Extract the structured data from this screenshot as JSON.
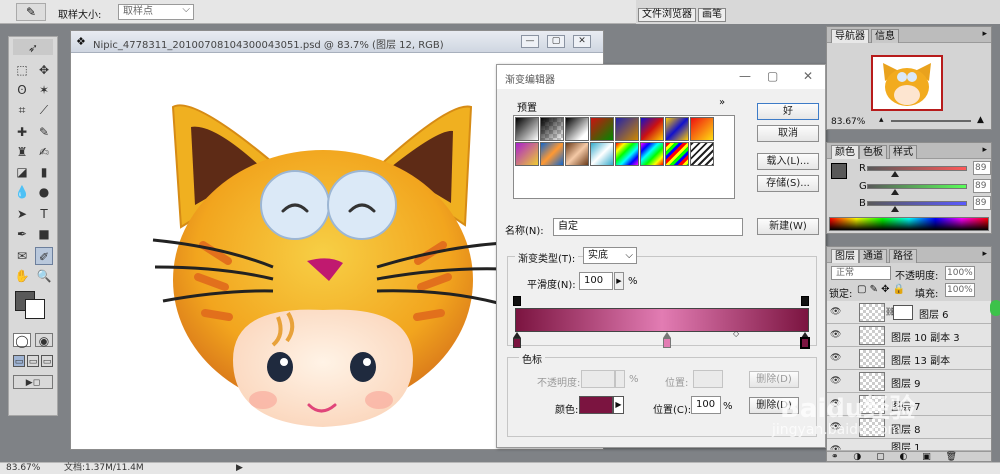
{
  "options_bar": {
    "sample_size_label": "取样大小:",
    "sample_size_value": "取样点"
  },
  "well_tabs": [
    "文件浏览器",
    "画笔"
  ],
  "document": {
    "title": "Nipic_4778311_20100708104300043051.psd @ 83.7% (图层 12, RGB)",
    "btn_min": "—",
    "btn_restore": "▢",
    "btn_close": "✕"
  },
  "status": {
    "zoom": "83.67%",
    "doc_info": "文档:1.37M/11.4M"
  },
  "gradient_editor": {
    "title": "渐变编辑器",
    "presets_label": "预置",
    "presets_more": "»",
    "buttons": {
      "ok": "好",
      "cancel": "取消",
      "load": "载入(L)...",
      "save": "存储(S)...",
      "new": "新建(W)"
    },
    "name_label": "名称(N):",
    "name_value": "自定",
    "gradient_type_label": "渐变类型(T):",
    "gradient_type_value": "实底",
    "smoothness_label": "平滑度(N):",
    "smoothness_value": "100",
    "smoothness_unit": "%",
    "gradient": {
      "start_color": "#7b1440",
      "mid_color": "#e27cb3",
      "end_color": "#7b1440"
    },
    "stops_label": "色标",
    "opacity_label": "不透明度:",
    "opacity_unit": "%",
    "opacity_location_label": "位置:",
    "delete_button_1": "删除(D)",
    "color_label": "颜色:",
    "color_value": "#7b1440",
    "location_label": "位置(C):",
    "location_value": "100",
    "location_unit": "%",
    "delete_button_2": "删除(D)"
  },
  "navigator_panel": {
    "tabs": [
      "导航器",
      "信息"
    ],
    "zoom": "83.67%"
  },
  "color_panel": {
    "tabs": [
      "颜色",
      "色板",
      "样式"
    ],
    "r_label": "R",
    "r_value": "89",
    "g_label": "G",
    "g_value": "89",
    "b_label": "B",
    "b_value": "89"
  },
  "layers_panel": {
    "tabs": [
      "图层",
      "通道",
      "路径"
    ],
    "blend_mode": "正常",
    "opacity_label": "不透明度:",
    "opacity_value": "100%",
    "lock_label": "锁定:",
    "fill_label": "填充:",
    "fill_value": "100%",
    "layers": [
      "图层 6",
      "图层 10 副本 3",
      "图层 13 副本",
      "图层 9",
      "图层 7",
      "图层 8",
      "图层 1"
    ]
  },
  "watermark": {
    "line1": "Baidu经验",
    "line2": "jingyan.baidu.com"
  }
}
